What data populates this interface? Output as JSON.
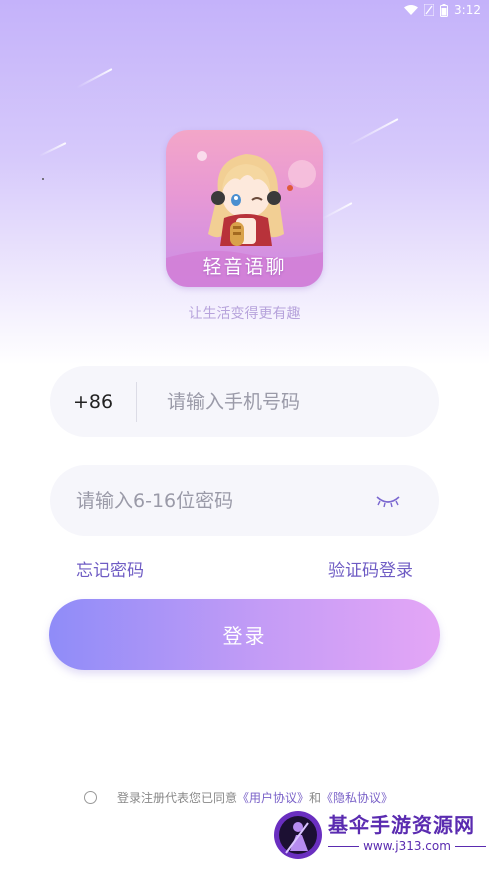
{
  "status_bar": {
    "time": "3:12",
    "icons": [
      "wifi-icon",
      "signal-icon",
      "battery-icon"
    ]
  },
  "app": {
    "logo_title": "轻音语聊",
    "slogan": "让生活变得更有趣"
  },
  "form": {
    "country_code": "+86",
    "phone_placeholder": "请输入手机号码",
    "password_placeholder": "请输入6-16位密码",
    "forgot_password": "忘记密码",
    "code_login": "验证码登录",
    "login_button": "登录"
  },
  "agreement": {
    "prefix": "登录注册代表您已同意",
    "user_agreement": "《用户协议》",
    "and": "和",
    "privacy_agreement": "《隐私协议》"
  },
  "watermark": {
    "site_name": "基伞手游资源网",
    "url": "www.j313.com"
  },
  "colors": {
    "accent": "#6f5cc4",
    "button_start": "#8f8cf8",
    "button_end": "#e4a6f6"
  }
}
